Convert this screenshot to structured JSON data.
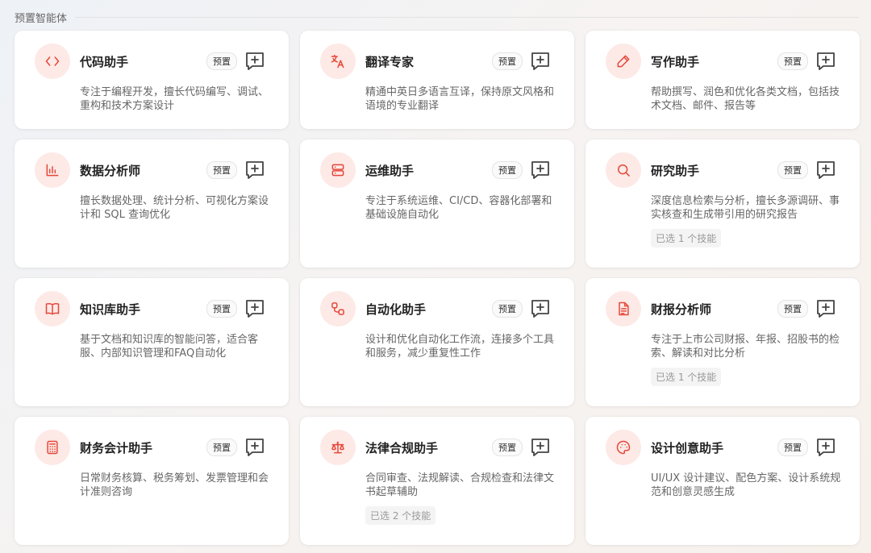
{
  "section": {
    "title": "预置智能体"
  },
  "badge_label": "预置",
  "cards": [
    {
      "title": "代码助手",
      "icon": "code-icon",
      "desc": "专注于编程开发，擅长代码编写、调试、重构和技术方案设计",
      "skills": ""
    },
    {
      "title": "翻译专家",
      "icon": "translate-icon",
      "desc": "精通中英日多语言互译，保持原文风格和语境的专业翻译",
      "skills": ""
    },
    {
      "title": "写作助手",
      "icon": "pen-icon",
      "desc": "帮助撰写、润色和优化各类文档，包括技术文档、邮件、报告等",
      "skills": ""
    },
    {
      "title": "数据分析师",
      "icon": "bar-chart-icon",
      "desc": "擅长数据处理、统计分析、可视化方案设计和 SQL 查询优化",
      "skills": ""
    },
    {
      "title": "运维助手",
      "icon": "server-icon",
      "desc": "专注于系统运维、CI/CD、容器化部署和基础设施自动化",
      "skills": ""
    },
    {
      "title": "研究助手",
      "icon": "search-icon",
      "desc": "深度信息检索与分析，擅长多源调研、事实核查和生成带引用的研究报告",
      "skills": "已选 1 个技能"
    },
    {
      "title": "知识库助手",
      "icon": "book-icon",
      "desc": "基于文档和知识库的智能问答，适合客服、内部知识管理和FAQ自动化",
      "skills": ""
    },
    {
      "title": "自动化助手",
      "icon": "workflow-icon",
      "desc": "设计和优化自动化工作流，连接多个工具和服务，减少重复性工作",
      "skills": ""
    },
    {
      "title": "财报分析师",
      "icon": "report-icon",
      "desc": "专注于上市公司财报、年报、招股书的检索、解读和对比分析",
      "skills": "已选 1 个技能"
    },
    {
      "title": "财务会计助手",
      "icon": "calculator-icon",
      "desc": "日常财务核算、税务筹划、发票管理和会计准则咨询",
      "skills": ""
    },
    {
      "title": "法律合规助手",
      "icon": "scale-icon",
      "desc": "合同审查、法规解读、合规检查和法律文书起草辅助",
      "skills": "已选 2 个技能"
    },
    {
      "title": "设计创意助手",
      "icon": "palette-icon",
      "desc": "UI/UX 设计建议、配色方案、设计系统规范和创意灵感生成",
      "skills": ""
    }
  ],
  "colors": {
    "accent": "#e5483a",
    "avatar_bg": "#fde9e6"
  }
}
